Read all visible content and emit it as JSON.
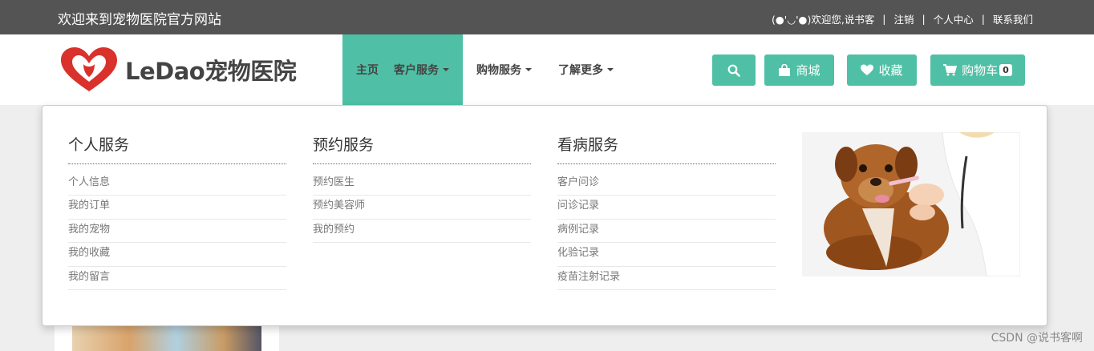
{
  "topbar": {
    "welcome": "欢迎来到宠物医院官方网站",
    "greeting": "(●'◡'●)欢迎您,说书客",
    "logout": "注销",
    "profile": "个人中心",
    "contact": "联系我们",
    "separator": "|"
  },
  "header": {
    "logo_text": "LeDao宠物医院",
    "nav": {
      "home": "主页",
      "customer": "客户服务",
      "shopping": "购物服务",
      "more": "了解更多"
    },
    "buttons": {
      "mall": "商城",
      "favorites": "收藏",
      "cart": "购物车",
      "cart_count": "0"
    }
  },
  "dropdown": {
    "columns": [
      {
        "title": "个人服务",
        "items": [
          "个人信息",
          "我的订单",
          "我的宠物",
          "我的收藏",
          "我的留言"
        ]
      },
      {
        "title": "预约服务",
        "items": [
          "预约医生",
          "预约美容师",
          "我的预约"
        ]
      },
      {
        "title": "看病服务",
        "items": [
          "客户问诊",
          "问诊记录",
          "病例记录",
          "化验记录",
          "疫苗注射记录"
        ]
      }
    ]
  },
  "watermark": "CSDN @说书客啊",
  "colors": {
    "accent": "#4fc0a5",
    "topbar": "#545454",
    "logo_red": "#d9312b"
  },
  "icons": [
    "search-icon",
    "shopping-bag-icon",
    "heart-icon",
    "cart-icon",
    "heart-logo-icon",
    "caret-down-icon"
  ]
}
